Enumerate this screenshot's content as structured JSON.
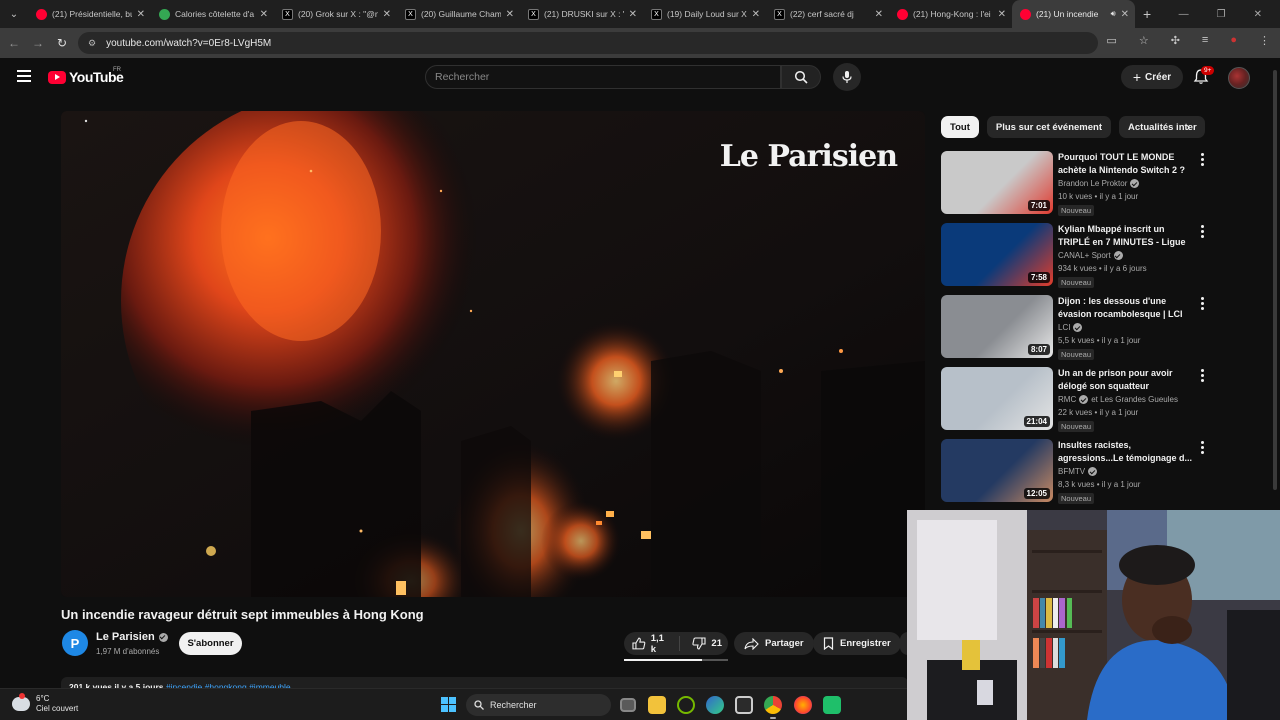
{
  "browser": {
    "tabs": [
      {
        "label": "(21) Présidentielle, bu",
        "icon": "youtube-icon"
      },
      {
        "label": "Calories côtelette d'a",
        "icon": "calories-icon"
      },
      {
        "label": "(20) Grok sur X : \"@n",
        "icon": "x-icon"
      },
      {
        "label": "(20) Guillaume Cham",
        "icon": "x-icon"
      },
      {
        "label": "(21) DRUSKI sur X : \"",
        "icon": "x-icon"
      },
      {
        "label": "(19) Daily Loud sur X",
        "icon": "x-icon"
      },
      {
        "label": "(22) cerf sacré dj",
        "icon": "x-icon"
      },
      {
        "label": "(21) Hong-Kong : l'ei",
        "icon": "youtube-icon"
      },
      {
        "label": "(21) Un incendie",
        "icon": "youtube-icon",
        "active": true
      }
    ],
    "url": "youtube.com/watch?v=0Er8-LVgH5M"
  },
  "youtube": {
    "logo_text": "YouTube",
    "country_code": "FR",
    "search_placeholder": "Rechercher",
    "create_label": "Créer",
    "notification_badge": "9+"
  },
  "video": {
    "overlay_logo": "Le Parisien",
    "title": "Un incendie ravageur détruit sept immeubles à Hong Kong",
    "channel_name": "Le Parisien",
    "channel_initial": "P",
    "subscribers": "1,97 M d'abonnés",
    "subscribe_label": "S'abonner",
    "likes": "1,1 k",
    "dislikes": "21",
    "like_ratio": 0.75,
    "share_label": "Partager",
    "save_label": "Enregistrer",
    "description_meta": "201 k vues  il y a 5 jours",
    "description_tags": "#incendie #hongkong #immeuble"
  },
  "sidebar": {
    "chips": [
      {
        "label": "Tout",
        "active": true
      },
      {
        "label": "Plus sur cet événement",
        "active": false
      },
      {
        "label": "Actualités inter",
        "active": false
      }
    ],
    "recommendations": [
      {
        "title": "Pourquoi TOUT LE MONDE achète la Nintendo Switch 2 ?",
        "channel": "Brandon Le Proktor",
        "verified": true,
        "meta": "10 k vues • il y a 1 jour",
        "badge": "Nouveau",
        "duration": "7:01",
        "thumb_colors": [
          "#c9c9c9",
          "#e03a2f"
        ]
      },
      {
        "title": "Kylian Mbappé inscrit un TRIPLÉ en 7 MINUTES - Ligue ...",
        "channel": "CANAL+ Sport",
        "verified": true,
        "meta": "934 k vues • il y a 6 jours",
        "badge": "Nouveau",
        "duration": "7:58",
        "thumb_colors": [
          "#0a3a7a",
          "#e23d2b"
        ]
      },
      {
        "title": "Dijon : les dessous d'une évasion rocambolesque | LCI",
        "channel": "LCI",
        "verified": true,
        "meta": "5,5 k vues • il y a 1 jour",
        "badge": "Nouveau",
        "duration": "8:07",
        "thumb_colors": [
          "#8a8d92",
          "#e8e8e8"
        ]
      },
      {
        "title": "Un an de prison pour avoir délogé son squatteur",
        "channel": "RMC",
        "verified": true,
        "channel_extra": "et Les Grandes Gueules",
        "meta": "22 k vues • il y a 1 jour",
        "badge": "Nouveau",
        "duration": "21:04",
        "thumb_colors": [
          "#b7c0c9",
          "#e4e4e4"
        ]
      },
      {
        "title": "Insultes racistes, agressions...Le témoignage d...",
        "channel": "BFMTV",
        "verified": true,
        "meta": "8,3 k vues • il y a 1 jour",
        "badge": "Nouveau",
        "duration": "12:05",
        "thumb_colors": [
          "#243a62",
          "#c98a63"
        ]
      }
    ]
  },
  "taskbar": {
    "temperature": "6°C",
    "weather": "Ciel couvert",
    "search_label": "Rechercher"
  }
}
